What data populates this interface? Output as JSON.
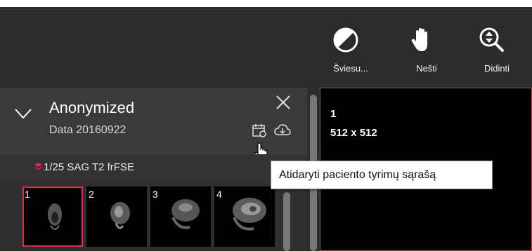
{
  "toolbar": {
    "tools": [
      {
        "label": "Šviesu...",
        "icon": "contrast-icon"
      },
      {
        "label": "Nešti",
        "icon": "hand-icon"
      },
      {
        "label": "Didinti",
        "icon": "zoom-icon"
      }
    ]
  },
  "study": {
    "patient_name": "Anonymized",
    "date_label": "Data 20160922"
  },
  "series": {
    "label": "1/25 SAG T2 frFSE"
  },
  "thumbnails": [
    {
      "num": "1",
      "selected": true
    },
    {
      "num": "2"
    },
    {
      "num": "3"
    },
    {
      "num": "4"
    }
  ],
  "viewport": {
    "image_number": "1",
    "dimensions": "512 x 512"
  },
  "tooltip": {
    "text": "Atidaryti paciento tyrimų sąrašą"
  },
  "colors": {
    "accent": "#e8244a",
    "toolbar_bg": "#2b2b2b",
    "panel_bg": "#3a3a3a"
  }
}
